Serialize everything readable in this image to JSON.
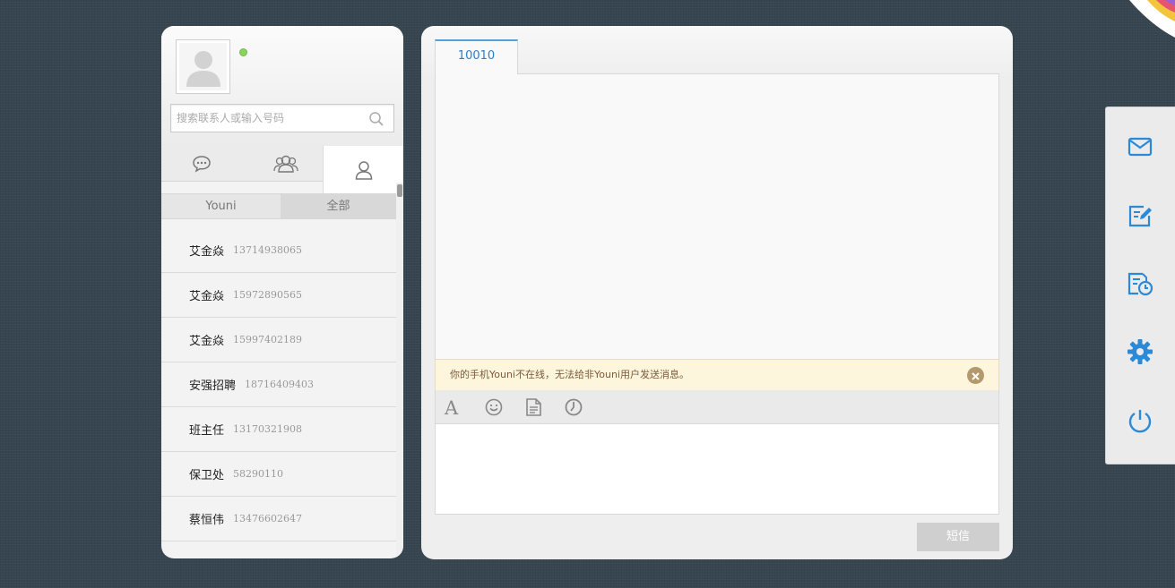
{
  "user": {
    "avatar_icon": "default-avatar-icon",
    "status_color": "#8ad35c"
  },
  "search": {
    "placeholder": "搜索联系人或输入号码",
    "value": ""
  },
  "contact_tabs": [
    {
      "icon": "chat-bubble-icon",
      "active": false
    },
    {
      "icon": "group-icon",
      "active": false
    },
    {
      "icon": "person-icon",
      "active": true
    }
  ],
  "filter": {
    "tabs": [
      {
        "label": "Youni",
        "active": false
      },
      {
        "label": "全部",
        "active": true
      }
    ]
  },
  "contacts": [
    {
      "name": "艾金焱",
      "phone": "13714938065"
    },
    {
      "name": "艾金焱",
      "phone": "15972890565"
    },
    {
      "name": "艾金焱",
      "phone": "15997402189"
    },
    {
      "name": "安强招聘",
      "phone": "18716409403"
    },
    {
      "name": "班主任",
      "phone": "13170321908"
    },
    {
      "name": "保卫处",
      "phone": "58290110"
    },
    {
      "name": "蔡恒伟",
      "phone": "13476602647"
    }
  ],
  "conversation": {
    "tab_label": "10010",
    "notice": "你的手机Youni不在线，无法给非Youni用户发送消息。",
    "compose_value": "",
    "send_label": "短信"
  },
  "toolbar": [
    "font-icon",
    "emoji-icon",
    "template-icon",
    "schedule-icon"
  ],
  "dock": [
    "mail-icon",
    "compose-icon",
    "scheduled-icon",
    "settings-icon",
    "power-icon"
  ],
  "colors": {
    "accent": "#2a8ad8",
    "background": "#36454f",
    "notice_bg": "#fdf6dc",
    "send_button": "#cfcfcf"
  }
}
